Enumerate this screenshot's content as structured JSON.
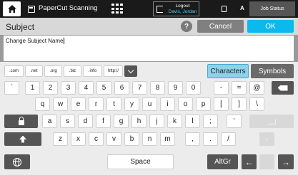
{
  "header": {
    "app_title": "PaperCut Scanning",
    "logout_label": "Logout",
    "logout_user": "Davis, Jordan",
    "lang_label": "A",
    "job_status_label": "Job Status"
  },
  "titlebar": {
    "title": "Subject",
    "help_label": "?",
    "cancel_label": "Cancel",
    "ok_label": "OK"
  },
  "input": {
    "value": "Change Subject Name"
  },
  "keyboard": {
    "domains": [
      ".com",
      ".net",
      ".org",
      ".biz",
      ".info",
      "http://"
    ],
    "mode_characters": "Characters",
    "mode_symbols": "Symbols",
    "row_numbers": [
      "`",
      "1",
      "2",
      "3",
      "4",
      "5",
      "6",
      "7",
      "8",
      "9",
      "0",
      "-",
      "=",
      "@"
    ],
    "row_q": [
      "q",
      "w",
      "e",
      "r",
      "t",
      "y",
      "u",
      "i",
      "o",
      "p",
      "[",
      "]",
      "\\"
    ],
    "row_a": [
      "a",
      "s",
      "d",
      "f",
      "g",
      "h",
      "j",
      "k",
      "l",
      ";",
      "'"
    ],
    "row_z": [
      "z",
      "x",
      "c",
      "v",
      "b",
      "n",
      "m",
      ",",
      ".",
      "/"
    ],
    "space_label": "Space",
    "altgr_label": "AltGr",
    "left_arrow": "←",
    "right_arrow": "→"
  },
  "colors": {
    "accent": "#0bb9ec",
    "topbar": "#1a1a1a",
    "mode_selected": "#8cd3ea"
  }
}
